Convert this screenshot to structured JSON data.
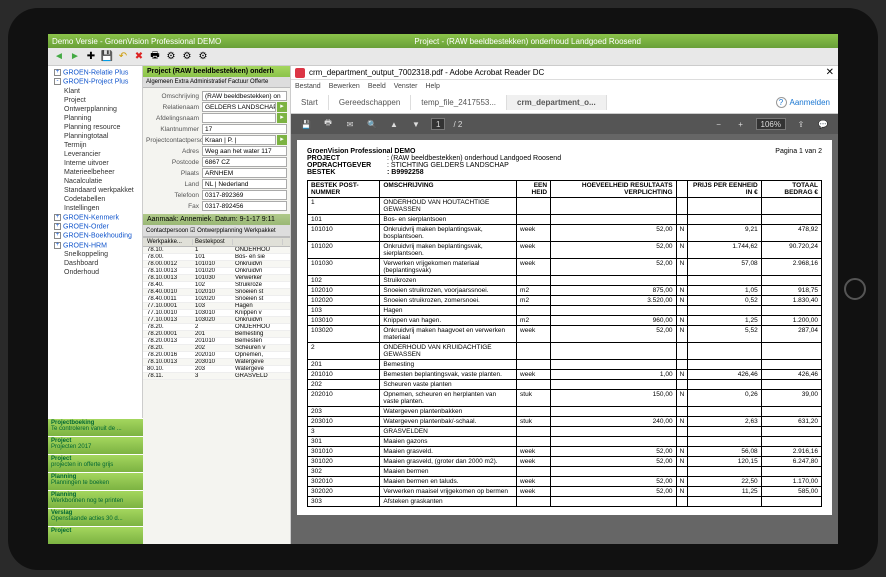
{
  "titlebar": {
    "app": "Demo Versie - GroenVision Professional DEMO",
    "doc": "Project - (RAW beeldbestekken) onderhoud Landgoed Roosend"
  },
  "tree": {
    "roots": [
      {
        "label": "GROEN-Relatie Plus",
        "exp": "+"
      },
      {
        "label": "GROEN-Project Plus",
        "exp": "-",
        "children": [
          {
            "label": "Klant"
          },
          {
            "label": "Project"
          },
          {
            "label": "Ontwerpplanning"
          },
          {
            "label": "Planning"
          },
          {
            "label": "Planning resource"
          },
          {
            "label": "Planningtotaal"
          },
          {
            "label": "Termijn"
          },
          {
            "label": "Leverancier"
          },
          {
            "label": "Interne uitvoer"
          },
          {
            "label": "Materieelbeheer"
          },
          {
            "label": "Nacalculatie"
          },
          {
            "label": "Standaard werkpakket"
          },
          {
            "label": "Codetabellen"
          },
          {
            "label": "Instellingen"
          }
        ]
      },
      {
        "label": "GROEN-Kenmerk",
        "exp": "+"
      },
      {
        "label": "GROEN-Order",
        "exp": "+"
      },
      {
        "label": "GROEN-Boekhouding",
        "exp": "+"
      },
      {
        "label": "GROEN-HRM",
        "exp": "+",
        "children": [
          {
            "label": "Snelkoppeling"
          },
          {
            "label": "Dashboard"
          },
          {
            "label": "Onderhoud"
          }
        ]
      }
    ]
  },
  "mid": {
    "header": "Project    (RAW beeldbestekken) onderh",
    "tabs": "Algemeen  Extra  Administratief  Factuur  Offerte",
    "form": [
      {
        "lbl": "Omschrijving",
        "val": "(RAW beeldbestekken) on"
      },
      {
        "lbl": "Relatienaam",
        "val": "GELDERS LANDSCHAP",
        "arrow": true
      },
      {
        "lbl": "Afdelingsnaam",
        "val": "",
        "arrow": true
      },
      {
        "lbl": "Klantnummer",
        "val": "17"
      },
      {
        "lbl": "Projectcontactpersoon",
        "val": "Kraan | P. |",
        "arrow": true
      },
      {
        "lbl": "Adres",
        "val": "Weg aan het water 117"
      },
      {
        "lbl": "Postcode",
        "val": "6867 CZ"
      },
      {
        "lbl": "Plaats",
        "val": "ARNHEM"
      },
      {
        "lbl": "Land",
        "val": "NL | Nederland"
      },
      {
        "lbl": "Telefoon",
        "val": "0317-892369"
      },
      {
        "lbl": "Fax",
        "val": "0317-892456"
      }
    ],
    "band": "Aanmaak: Annemiek.     Datum: 9-1-17  9:11",
    "tabs2": "Contactpersoon   ☑ Ontwerpplanning   Werkpakket",
    "gridhdr": [
      "Werkpakke...",
      "Bestekpost",
      ""
    ],
    "grid": [
      [
        "78.10.",
        "1",
        "ONDERHOU"
      ],
      [
        "78.00.",
        "101",
        "Bos- en sie"
      ],
      [
        "78.00.0012",
        "101010",
        "Onkruidvri"
      ],
      [
        "78.10.0013",
        "101020",
        "Onkruidvri"
      ],
      [
        "78.10.0013",
        "101030",
        "Verwerker"
      ],
      [
        "78.40.",
        "102",
        "Struikroze"
      ],
      [
        "78.40.0010",
        "102010",
        "Snoeien st"
      ],
      [
        "78.40.0011",
        "102020",
        "Snoeien st"
      ],
      [
        "77.10.0001",
        "103",
        "Hagen"
      ],
      [
        "77.10.0010",
        "103010",
        "Knippen v"
      ],
      [
        "77.10.0013",
        "103020",
        "Onkruidvri"
      ],
      [
        "78.20.",
        "2",
        "ONDERHOU"
      ],
      [
        "78.20.0001",
        "201",
        "Bemesting"
      ],
      [
        "78.20.0013",
        "201010",
        "Bemesten"
      ],
      [
        "78.20.",
        "202",
        "Scheuren v"
      ],
      [
        "78.20.0016",
        "202010",
        "Opnemen,"
      ],
      [
        "78.10.0013",
        "203010",
        "Watergeve"
      ],
      [
        "80.10.",
        "203",
        "Watergeve"
      ],
      [
        "78.11.",
        "3",
        "GRASVELD"
      ]
    ]
  },
  "stacks": [
    {
      "t": "Projectboeking",
      "s": "Te controleren vanuit de ..."
    },
    {
      "t": "Project",
      "s": "Projecten 2017"
    },
    {
      "t": "Project",
      "s": "projecten in offerte grijs"
    },
    {
      "t": "Planning",
      "s": "Planningen te boeken"
    },
    {
      "t": "Planning",
      "s": "Werkbonnen nog te printen"
    },
    {
      "t": "Verslag",
      "s": "Openstaande acties 30 d..."
    },
    {
      "t": "Project",
      "s": ""
    }
  ],
  "pdf": {
    "title": "crm_department_output_7002318.pdf - Adobe Acrobat Reader DC",
    "menu": [
      "Bestand",
      "Bewerken",
      "Beeld",
      "Venster",
      "Help"
    ],
    "tabs": [
      {
        "l": "Start"
      },
      {
        "l": "Gereedschappen"
      },
      {
        "l": "temp_file_2417553..."
      },
      {
        "l": "crm_department_o...",
        "active": true
      }
    ],
    "login": "Aanmelden",
    "page": "1",
    "pages": "2",
    "zoom": "106%",
    "doc": {
      "company": "GroenVision Professional DEMO",
      "pageno": "Pagina 1 van  2",
      "project_k": "PROJECT",
      "project_v": ": (RAW beeldbestekken) onderhoud Landgoed Roosend",
      "opdr_k": "OPDRACHTGEVER",
      "opdr_v": ": STICHTING GELDERS LANDSCHAP",
      "bestek_k": "BESTEK",
      "bestek_v": ": B9992258",
      "cols": [
        "BESTEK POST-NUMMER",
        "OMSCHRIJVING",
        "EEN HEID",
        "HOEVEELHEID RESULTAATS VERPLICHTING",
        "",
        "PRIJS PER EENHEID IN €",
        "TOTAAL BEDRAG €"
      ],
      "rows": [
        [
          "1",
          "ONDERHOUD VAN HOUTACHTIGE GEWASSEN",
          "",
          "",
          "",
          "",
          ""
        ],
        [
          "101",
          "Bos- en sierplantsoen",
          "",
          "",
          "",
          "",
          ""
        ],
        [
          "101010",
          "Onkruidvrij maken beplantingsvak, bosplantsoen.",
          "week",
          "52,00",
          "N",
          "9,21",
          "478,92"
        ],
        [
          "101020",
          "Onkruidvrij maken beplantingsvak, sierplantsoen.",
          "week",
          "52,00",
          "N",
          "1.744,62",
          "90.720,24"
        ],
        [
          "101030",
          "Verwerken vrijgekomen materiaal (beplantingsvak)",
          "week",
          "52,00",
          "N",
          "57,08",
          "2.968,16"
        ],
        [
          "102",
          "Struikrozen",
          "",
          "",
          "",
          "",
          ""
        ],
        [
          "102010",
          "Snoeien struikrozen, voorjaarssnoei.",
          "m2",
          "875,00",
          "N",
          "1,05",
          "918,75"
        ],
        [
          "102020",
          "Snoeien struikrozen, zomersnoei.",
          "m2",
          "3.520,00",
          "N",
          "0,52",
          "1.830,40"
        ],
        [
          "103",
          "Hagen",
          "",
          "",
          "",
          "",
          ""
        ],
        [
          "103010",
          "Knippen van hagen.",
          "m2",
          "960,00",
          "N",
          "1,25",
          "1.200,00"
        ],
        [
          "103020",
          "Onkruidvrij maken haagvoet en verwerken materiaal",
          "week",
          "52,00",
          "N",
          "5,52",
          "287,04"
        ],
        [
          "2",
          "ONDERHOUD VAN KRUIDACHTIGE GEWASSEN",
          "",
          "",
          "",
          "",
          ""
        ],
        [
          "201",
          "Bemesting",
          "",
          "",
          "",
          "",
          ""
        ],
        [
          "201010",
          "Bemesten beplantingsvak, vaste planten.",
          "week",
          "1,00",
          "N",
          "426,46",
          "426,46"
        ],
        [
          "202",
          "Scheuren vaste planten",
          "",
          "",
          "",
          "",
          ""
        ],
        [
          "202010",
          "Opnemen, scheuren en herplanten van vaste planten.",
          "stuk",
          "150,00",
          "N",
          "0,26",
          "39,00"
        ],
        [
          "203",
          "Watergeven plantenbakken",
          "",
          "",
          "",
          "",
          ""
        ],
        [
          "203010",
          "Watergeven plantenbak/-schaal.",
          "stuk",
          "240,00",
          "N",
          "2,63",
          "631,20"
        ],
        [
          "3",
          "GRASVELDEN",
          "",
          "",
          "",
          "",
          ""
        ],
        [
          "301",
          "Maaien gazons",
          "",
          "",
          "",
          "",
          ""
        ],
        [
          "301010",
          "Maaien grasveld.",
          "week",
          "52,00",
          "N",
          "56,08",
          "2.916,16"
        ],
        [
          "301020",
          "Maaien grasveld, (groter dan 2000 m2).",
          "week",
          "52,00",
          "N",
          "120,15",
          "6.247,80"
        ],
        [
          "302",
          "Maaien bermen",
          "",
          "",
          "",
          "",
          ""
        ],
        [
          "302010",
          "Maaien bermen en taluds.",
          "week",
          "52,00",
          "N",
          "22,50",
          "1.170,00"
        ],
        [
          "302020",
          "Verwerken maaisel vrijgekomen op bermen",
          "week",
          "52,00",
          "N",
          "11,25",
          "585,00"
        ],
        [
          "303",
          "Afsteken graskanten",
          "",
          "",
          "",
          "",
          ""
        ]
      ]
    }
  }
}
